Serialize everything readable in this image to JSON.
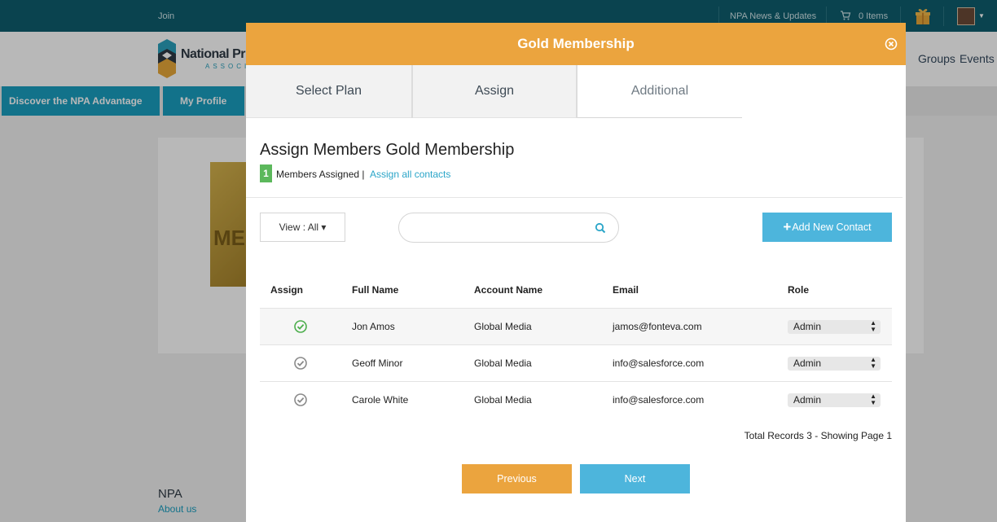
{
  "site": {
    "topbar": {
      "join_label": "Join",
      "news_label": "NPA News & Updates",
      "cart_label": "0 Items",
      "cart_icon": "cart-icon",
      "gift_icon": "gift-icon",
      "avatar": "user-avatar"
    },
    "header": {
      "logo_text": "National Pr",
      "logo_sub": "ASSOCI",
      "nav_right": [
        "Groups",
        "Events"
      ]
    },
    "nav": [
      "Discover the NPA Advantage",
      "My Profile"
    ],
    "hero_image_text": "ME",
    "footer": {
      "title": "NPA",
      "link": "About us"
    }
  },
  "modal": {
    "title": "Gold Membership",
    "close_icon": "close-icon",
    "tabs": [
      {
        "label": "Select Plan",
        "active": false
      },
      {
        "label": "Assign",
        "active": false
      },
      {
        "label": "Additional",
        "active": true
      }
    ],
    "heading": "Assign Members Gold Membership",
    "assigned_count": "1",
    "assigned_label": "Members Assigned |",
    "assign_all_label": "Assign all contacts",
    "view_label": "View : All ▾",
    "search": {
      "placeholder": "",
      "value": ""
    },
    "add_contact_label": "Add New Contact",
    "table": {
      "headers": [
        "Assign",
        "Full Name",
        "Account Name",
        "Email",
        "Role"
      ],
      "rows": [
        {
          "assigned": true,
          "full_name": "Jon Amos",
          "account": "Global Media",
          "email": "jamos@fonteva.com",
          "role": "Admin"
        },
        {
          "assigned": false,
          "full_name": "Geoff Minor",
          "account": "Global Media",
          "email": "info@salesforce.com",
          "role": "Admin"
        },
        {
          "assigned": false,
          "full_name": "Carole White",
          "account": "Global Media",
          "email": "info@salesforce.com",
          "role": "Admin"
        }
      ]
    },
    "total_records": "Total Records 3 - Showing Page 1",
    "previous_label": "Previous",
    "next_label": "Next"
  },
  "colors": {
    "accent_orange": "#eba43e",
    "accent_blue": "#4db5dc",
    "topbar": "#0f5e6e",
    "assigned_green": "#5cb85c"
  }
}
